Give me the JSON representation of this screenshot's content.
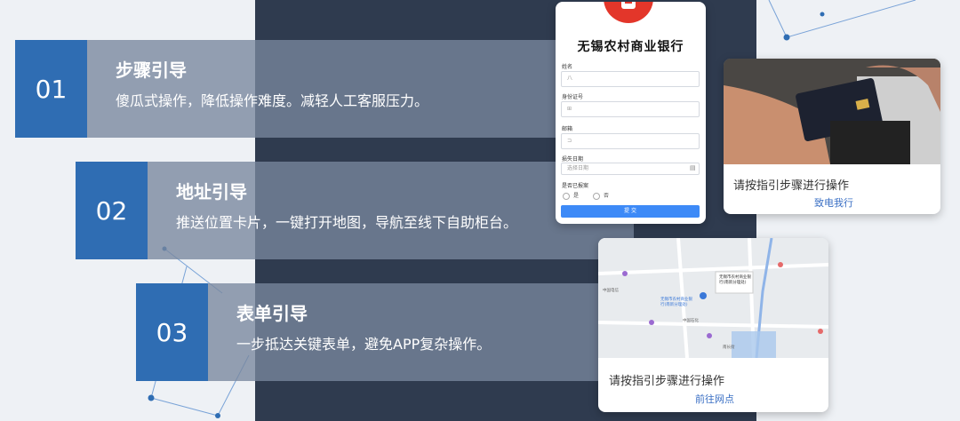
{
  "steps": [
    {
      "num": "01",
      "title": "步骤引导",
      "desc": "傻瓜式操作，降低操作难度。减轻人工客服压力。"
    },
    {
      "num": "02",
      "title": "地址引导",
      "desc": "推送位置卡片，一键打开地图，导航至线下自助柜台。"
    },
    {
      "num": "03",
      "title": "表单引导",
      "desc": "一步抵达关键表单，避免APP复杂操作。"
    }
  ],
  "form_card": {
    "bank_name": "无锡农村商业银行",
    "fields": [
      {
        "label": "姓名",
        "value": "八"
      },
      {
        "label": "身份证号",
        "value": "⊞"
      },
      {
        "label": "邮箱",
        "value": "⊐"
      },
      {
        "label": "损失日期",
        "value": "选择日期"
      }
    ],
    "question": "是否已报案",
    "options": [
      "是",
      "否"
    ],
    "submit": "提 交",
    "colors": {
      "logo": "#e3362a",
      "button": "#3d8af7"
    }
  },
  "photo_card": {
    "text": "请按指引步骤进行操作",
    "link": "致电我行"
  },
  "map_card": {
    "text": "请按指引步骤进行操作",
    "link": "前往网点",
    "map_labels": [
      "无锡市农村商业银行(南新分理处)",
      "无锡市农村商业银行(南新分理处)",
      "中国电信",
      "中国石化",
      "南长街"
    ]
  },
  "colors": {
    "panel": "#2f3b4f",
    "number_block": "#2f6db3",
    "bg": "#eef1f5"
  }
}
